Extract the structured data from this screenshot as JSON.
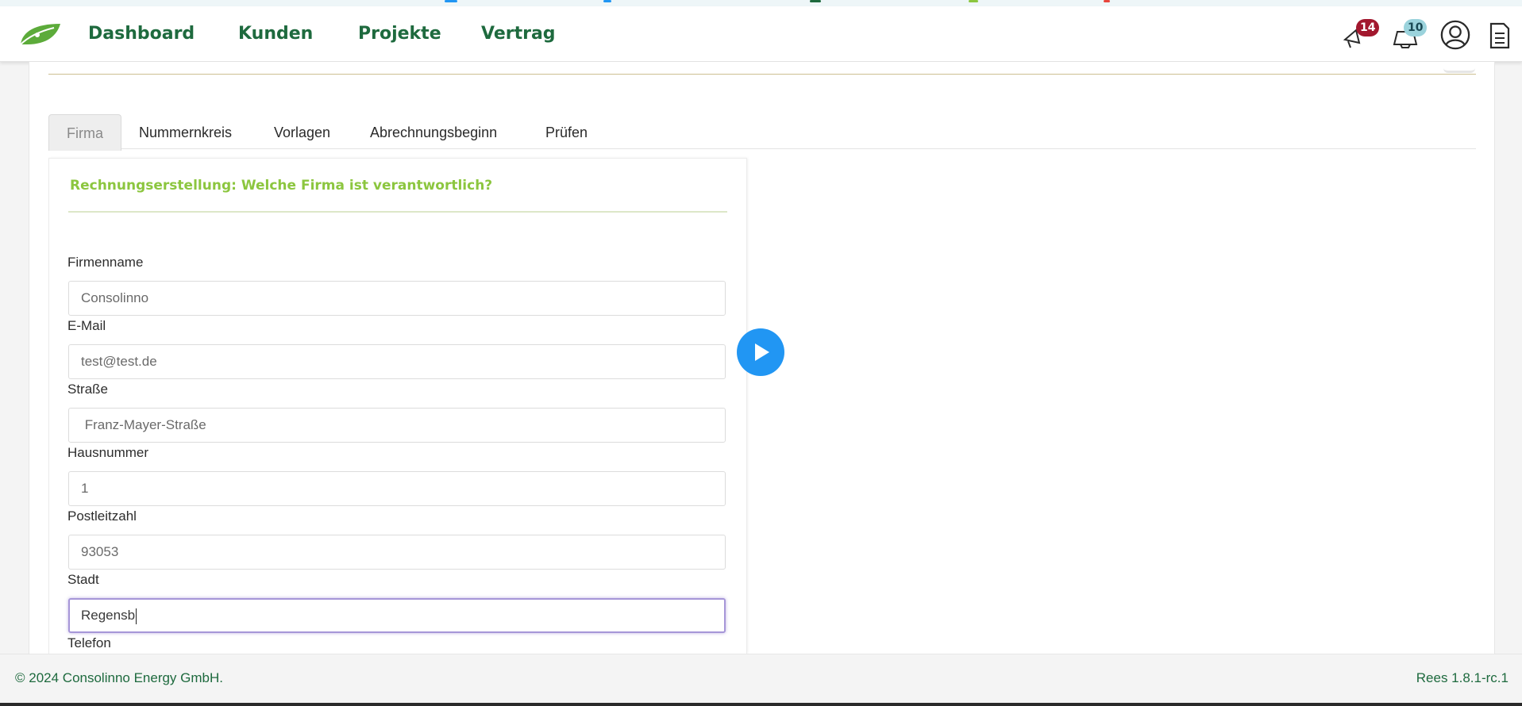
{
  "header": {
    "nav": [
      {
        "label": "Dashboard"
      },
      {
        "label": "Kunden"
      },
      {
        "label": "Projekte"
      },
      {
        "label": "Vertrag"
      }
    ],
    "notifications_badge": "14",
    "messages_badge": "10"
  },
  "tabs": [
    {
      "label": "Firma",
      "active": true
    },
    {
      "label": "Nummernkreis"
    },
    {
      "label": "Vorlagen"
    },
    {
      "label": "Abrechnungsbeginn"
    },
    {
      "label": "Prüfen"
    }
  ],
  "form": {
    "title": "Rechnungserstellung: Welche Firma ist verantwortlich?",
    "fields": [
      {
        "label": "Firmenname",
        "value": "Consolinno"
      },
      {
        "label": "E-Mail",
        "value": "test@test.de"
      },
      {
        "label": "Straße",
        "value": " Franz-Mayer-Straße"
      },
      {
        "label": "Hausnummer",
        "value": "1"
      },
      {
        "label": "Postleitzahl",
        "value": "93053"
      },
      {
        "label": "Stadt",
        "value": "Regensb"
      },
      {
        "label": "Telefon",
        "value": ""
      }
    ]
  },
  "footer": {
    "copyright": "© 2024 Consolinno Energy GmbH.",
    "version": "Rees 1.8.1-rc.1"
  },
  "colors": {
    "brand_green": "#1e6a3e",
    "accent_lime": "#8cc63f",
    "badge_red": "#a2182e",
    "badge_teal": "#9bd3dc",
    "play_blue": "#2196f3",
    "focus_purple": "#a696d8"
  },
  "icons": {
    "logo": "leaf-logo",
    "notifications": "megaphone-icon",
    "messages": "inbox-icon",
    "profile": "user-icon",
    "docs": "document-icon",
    "play": "play-icon"
  }
}
